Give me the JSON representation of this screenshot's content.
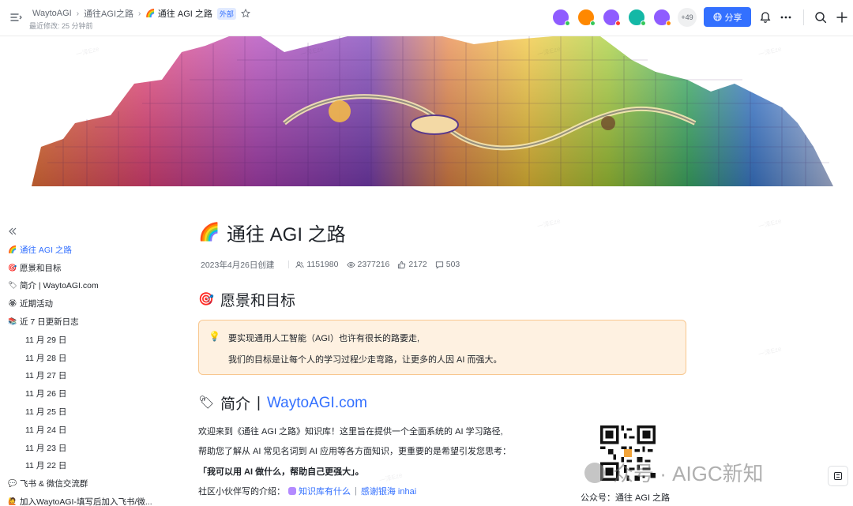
{
  "header": {
    "breadcrumbs": [
      "WaytoAGI",
      "通往AGI之路",
      "通往 AGI 之路"
    ],
    "current_emoji": "🌈",
    "external_badge": "外部",
    "last_modified": "最近修改: 25 分钟前",
    "more_count": "+49",
    "share_label": "分享",
    "avatar_colors": [
      "#8f5cff",
      "#ff8800",
      "#8f5cff",
      "#14b8a6",
      "#8f5cff"
    ],
    "status_dot_colors": [
      "#34c759",
      "#34c759",
      "#ff3b30",
      "#34c759",
      "#ff8800"
    ],
    "accent": "#3370ff"
  },
  "sidebar": {
    "items": [
      {
        "icon": "rainbow-icon",
        "glyph": "🌈",
        "label": "通往 AGI 之路",
        "level": 1,
        "active": true
      },
      {
        "icon": "target-icon",
        "glyph": "🎯",
        "label": "愿景和目标",
        "level": 1,
        "active": false
      },
      {
        "icon": "tag-icon",
        "glyph": "🏷",
        "label": "简介 | WaytoAGI.com",
        "level": 1,
        "active": false
      },
      {
        "icon": "flower-icon",
        "glyph": "🏵",
        "label": "近期活动",
        "level": 1,
        "active": false
      },
      {
        "icon": "log-icon",
        "glyph": "📚",
        "label": "近 7 日更新日志",
        "level": 1,
        "active": false
      },
      {
        "label": "11 月 29 日",
        "level": 2
      },
      {
        "label": "11 月 28 日",
        "level": 2
      },
      {
        "label": "11 月 27 日",
        "level": 2
      },
      {
        "label": "11 月 26 日",
        "level": 2
      },
      {
        "label": "11 月 25 日",
        "level": 2
      },
      {
        "label": "11 月 24 日",
        "level": 2
      },
      {
        "label": "11 月 23 日",
        "level": 2
      },
      {
        "label": "11 月 22 日",
        "level": 2
      },
      {
        "icon": "chat-icon",
        "glyph": "💬",
        "label": "飞书 & 微信交流群",
        "level": 1,
        "active": false
      },
      {
        "icon": "person-icon",
        "glyph": "🙋",
        "label": "加入WaytoAGI-填写后加入飞书/微...",
        "level": 1,
        "active": false
      }
    ]
  },
  "doc": {
    "title_emoji": "🌈",
    "title": "通往 AGI 之路",
    "created": "2023年4月26日创建",
    "stats": {
      "members": "1151980",
      "views": "2377216",
      "likes": "2172",
      "comments": "503"
    },
    "vision": {
      "emoji": "🎯",
      "heading": "愿景和目标",
      "callout_line1": "要实现通用人工智能（AGI）也许有很长的路要走,",
      "callout_line2": "我们的目标是让每个人的学习过程少走弯路，让更多的人因 AI 而强大。"
    },
    "intro": {
      "emoji": "🏷",
      "heading_prefix": "简介",
      "heading_bar": "|",
      "heading_link": "WaytoAGI.com",
      "para1": "欢迎来到《通往 AGI 之路》知识库！这里旨在提供一个全面系统的 AI 学习路径,",
      "para2": "帮助您了解从 AI 常见名词到 AI 应用等各方面知识，更重要的是希望引发您思考：",
      "para3": "「我可以用 AI 做什么，帮助自己更强大」。",
      "para4_label": "社区小伙伴写的介绍：",
      "link1": "知识库有什么",
      "link_sep": "|",
      "link2": "感谢银海 inhai",
      "qr_caption": "公众号：通往 AGI 之路"
    }
  },
  "watermark": {
    "text": "众号 · AIGC新知",
    "bg_text": "一泽Eze"
  }
}
